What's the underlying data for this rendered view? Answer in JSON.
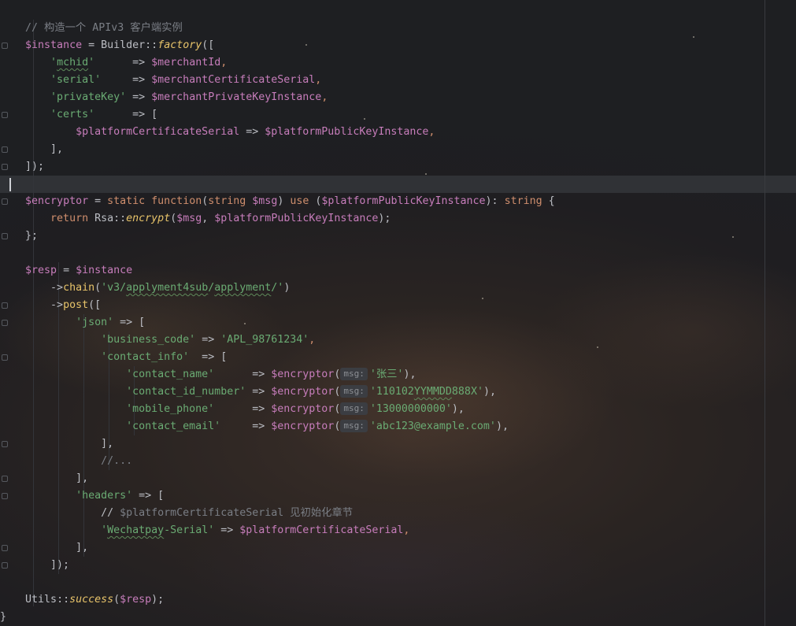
{
  "editor": {
    "lines": [
      [
        {
          "t": "    // ",
          "c": "cm"
        },
        {
          "t": "构造一个 APIv3 客户端实例",
          "c": "cm"
        }
      ],
      [
        {
          "t": "    "
        },
        {
          "t": "$instance",
          "c": "var"
        },
        {
          "t": " = "
        },
        {
          "t": "Builder",
          "c": "cls"
        },
        {
          "t": "::"
        },
        {
          "t": "factory",
          "c": "fni"
        },
        {
          "t": "(["
        }
      ],
      [
        {
          "t": "        "
        },
        {
          "t": "'",
          "c": "str"
        },
        {
          "t": "mchid",
          "c": "str wavy"
        },
        {
          "t": "'",
          "c": "str"
        },
        {
          "t": "      => "
        },
        {
          "t": "$merchantId",
          "c": "var"
        },
        {
          "t": ",",
          "c": "kw"
        }
      ],
      [
        {
          "t": "        "
        },
        {
          "t": "'serial'",
          "c": "str"
        },
        {
          "t": "     => "
        },
        {
          "t": "$merchantCertificateSerial",
          "c": "var"
        },
        {
          "t": ",",
          "c": "kw"
        }
      ],
      [
        {
          "t": "        "
        },
        {
          "t": "'privateKey'",
          "c": "str"
        },
        {
          "t": " => "
        },
        {
          "t": "$merchantPrivateKeyInstance",
          "c": "var"
        },
        {
          "t": ",",
          "c": "kw"
        }
      ],
      [
        {
          "t": "        "
        },
        {
          "t": "'certs'",
          "c": "str"
        },
        {
          "t": "      => ["
        }
      ],
      [
        {
          "t": "            "
        },
        {
          "t": "$platformCertificateSerial",
          "c": "var"
        },
        {
          "t": " => "
        },
        {
          "t": "$platformPublicKeyInstance",
          "c": "var"
        },
        {
          "t": ",",
          "c": "kw"
        }
      ],
      [
        {
          "t": "        ],",
          "c": "pl"
        }
      ],
      [
        {
          "t": "    ]);",
          "c": "pl"
        }
      ],
      [
        {
          "t": ""
        }
      ],
      [
        {
          "t": "    "
        },
        {
          "t": "$encryptor",
          "c": "var"
        },
        {
          "t": " = "
        },
        {
          "t": "static function",
          "c": "kw"
        },
        {
          "t": "("
        },
        {
          "t": "string",
          "c": "kw"
        },
        {
          "t": " "
        },
        {
          "t": "$msg",
          "c": "var"
        },
        {
          "t": ") "
        },
        {
          "t": "use",
          "c": "kw"
        },
        {
          "t": " ("
        },
        {
          "t": "$platformPublicKeyInstance",
          "c": "var"
        },
        {
          "t": "): "
        },
        {
          "t": "string",
          "c": "kw"
        },
        {
          "t": " {"
        }
      ],
      [
        {
          "t": "        "
        },
        {
          "t": "return",
          "c": "kw"
        },
        {
          "t": " "
        },
        {
          "t": "Rsa",
          "c": "cls"
        },
        {
          "t": "::"
        },
        {
          "t": "encrypt",
          "c": "fni"
        },
        {
          "t": "("
        },
        {
          "t": "$msg",
          "c": "var"
        },
        {
          "t": ", "
        },
        {
          "t": "$platformPublicKeyInstance",
          "c": "var"
        },
        {
          "t": ");"
        }
      ],
      [
        {
          "t": "    };",
          "c": "pl"
        }
      ],
      [
        {
          "t": ""
        }
      ],
      [
        {
          "t": "    "
        },
        {
          "t": "$resp",
          "c": "var"
        },
        {
          "t": " = "
        },
        {
          "t": "$instance",
          "c": "var"
        }
      ],
      [
        {
          "t": "        ->"
        },
        {
          "t": "chain",
          "c": "call"
        },
        {
          "t": "("
        },
        {
          "t": "'v3/",
          "c": "str"
        },
        {
          "t": "applyment4sub",
          "c": "str wavy"
        },
        {
          "t": "/",
          "c": "str"
        },
        {
          "t": "applyment",
          "c": "str wavy"
        },
        {
          "t": "/'",
          "c": "str"
        },
        {
          "t": ")"
        }
      ],
      [
        {
          "t": "        ->"
        },
        {
          "t": "post",
          "c": "call"
        },
        {
          "t": "(["
        }
      ],
      [
        {
          "t": "            "
        },
        {
          "t": "'json'",
          "c": "str"
        },
        {
          "t": " => ["
        }
      ],
      [
        {
          "t": "                "
        },
        {
          "t": "'business_code'",
          "c": "str"
        },
        {
          "t": " => "
        },
        {
          "t": "'APL_98761234'",
          "c": "str"
        },
        {
          "t": ",",
          "c": "kw"
        }
      ],
      [
        {
          "t": "                "
        },
        {
          "t": "'contact_info'",
          "c": "str"
        },
        {
          "t": "  => ["
        }
      ],
      [
        {
          "t": "                    "
        },
        {
          "t": "'contact_name'",
          "c": "str"
        },
        {
          "t": "      => "
        },
        {
          "t": "$encryptor",
          "c": "var"
        },
        {
          "t": "("
        },
        {
          "t": "msg:",
          "c": "hint"
        },
        {
          "t": "'张三'",
          "c": "str"
        },
        {
          "t": "),"
        }
      ],
      [
        {
          "t": "                    "
        },
        {
          "t": "'contact_id_number'",
          "c": "str"
        },
        {
          "t": " => "
        },
        {
          "t": "$encryptor",
          "c": "var"
        },
        {
          "t": "("
        },
        {
          "t": "msg:",
          "c": "hint"
        },
        {
          "t": "'110102",
          "c": "str"
        },
        {
          "t": "YYMMDD",
          "c": "str wavy"
        },
        {
          "t": "888X'",
          "c": "str"
        },
        {
          "t": "),"
        }
      ],
      [
        {
          "t": "                    "
        },
        {
          "t": "'mobile_phone'",
          "c": "str"
        },
        {
          "t": "      => "
        },
        {
          "t": "$encryptor",
          "c": "var"
        },
        {
          "t": "("
        },
        {
          "t": "msg:",
          "c": "hint"
        },
        {
          "t": "'13000000000'",
          "c": "str"
        },
        {
          "t": "),"
        }
      ],
      [
        {
          "t": "                    "
        },
        {
          "t": "'contact_email'",
          "c": "str"
        },
        {
          "t": "     => "
        },
        {
          "t": "$encryptor",
          "c": "var"
        },
        {
          "t": "("
        },
        {
          "t": "msg:",
          "c": "hint"
        },
        {
          "t": "'abc123@example.com'",
          "c": "str"
        },
        {
          "t": "),"
        }
      ],
      [
        {
          "t": "                ],",
          "c": "pl"
        }
      ],
      [
        {
          "t": "                //...",
          "c": "cm"
        }
      ],
      [
        {
          "t": "            ],",
          "c": "pl"
        }
      ],
      [
        {
          "t": "            "
        },
        {
          "t": "'headers'",
          "c": "str"
        },
        {
          "t": " => ["
        }
      ],
      [
        {
          "t": "                // "
        },
        {
          "t": "$platformCertificateSerial 见初始化章节",
          "c": "cm"
        }
      ],
      [
        {
          "t": "                "
        },
        {
          "t": "'",
          "c": "str"
        },
        {
          "t": "Wechatpay",
          "c": "str wavy"
        },
        {
          "t": "-Serial'",
          "c": "str"
        },
        {
          "t": " => "
        },
        {
          "t": "$platformCertificateSerial",
          "c": "var"
        },
        {
          "t": ",",
          "c": "kw"
        }
      ],
      [
        {
          "t": "            ],",
          "c": "pl"
        }
      ],
      [
        {
          "t": "        ]);",
          "c": "pl"
        }
      ],
      [
        {
          "t": ""
        }
      ],
      [
        {
          "t": "    "
        },
        {
          "t": "Utils",
          "c": "cls"
        },
        {
          "t": "::"
        },
        {
          "t": "success",
          "c": "fni"
        },
        {
          "t": "("
        },
        {
          "t": "$resp",
          "c": "var"
        },
        {
          "t": ");"
        }
      ],
      [
        {
          "t": "}"
        }
      ]
    ]
  }
}
